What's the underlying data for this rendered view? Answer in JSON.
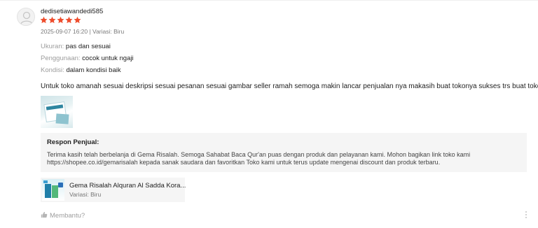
{
  "review": {
    "username": "dedisetiawandedi585",
    "rating": 5,
    "star_color": "#ee4d2d",
    "meta": "2025-09-07 16:20 | Variasi: Biru",
    "attributes": [
      {
        "key": "Ukuran:",
        "value": "pas dan sesuai"
      },
      {
        "key": "Penggunaan:",
        "value": "cocok untuk ngaji"
      },
      {
        "key": "Kondisi:",
        "value": "dalam kondisi baik"
      }
    ],
    "comment": "Untuk toko amanah sesuai deskripsi sesuai pesanan sesuai gambar seller ramah semoga makin lancar penjualan nya makasih buat tokonya sukses trs buat tokonya",
    "comment_emoji": "thumbs-up-emoji",
    "media_count": 1
  },
  "seller_response": {
    "title": "Respon Penjual:",
    "text": "Terima kasih telah berbelanja di Gema Risalah. Semoga Sahabat Baca Qur'an puas dengan produk dan pelayanan kami. Mohon bagikan link toko kami https://shopee.co.id/gemarisalah kepada sanak saudara dan favoritkan Toko kami untuk terus update mengenai discount dan produk terbaru."
  },
  "product": {
    "name": "Gema Risalah Alquran Al Sadda Kora...",
    "variation": "Variasi: Biru"
  },
  "actions": {
    "helpful_label": "Membantu?",
    "helpful_icon": "thumbs-up-icon",
    "more_icon": "more-vertical-icon"
  }
}
